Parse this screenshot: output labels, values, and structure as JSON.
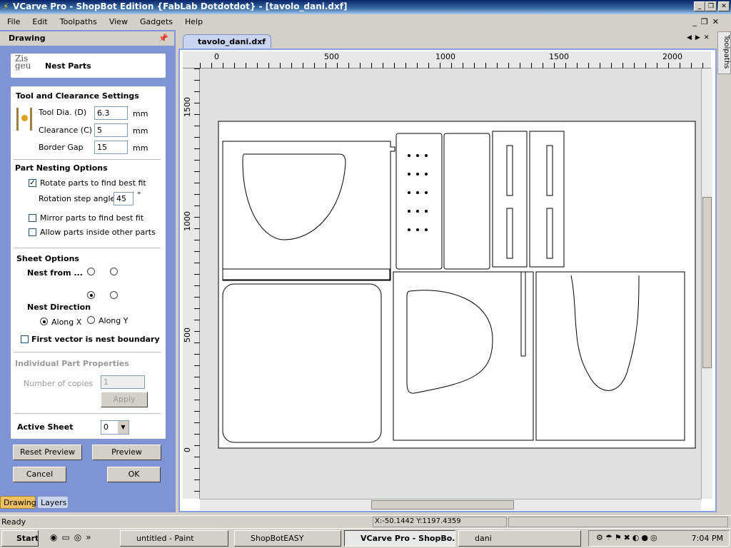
{
  "window": {
    "title": "VCarve Pro - ShopBot Edition {FabLab Dotdotdot} - [tavolo_dani.dxf]"
  },
  "menu": [
    "File",
    "Edit",
    "Toolpaths",
    "View",
    "Gadgets",
    "Help"
  ],
  "panel": {
    "title": "Drawing",
    "gadget_title": "Nest Parts",
    "tool_section": "Tool and Clearance Settings",
    "tool_dia_label": "Tool Dia. (D)",
    "tool_dia": "6.3",
    "clearance_label": "Clearance (C)",
    "clearance": "5",
    "border_label": "Border Gap",
    "border": "15",
    "unit": "mm",
    "nesting_section": "Part Nesting Options",
    "rotate_label": "Rotate parts to find best fit",
    "rotate_checked": true,
    "rotation_step_label": "Rotation step angle",
    "rotation_step": "45",
    "degree": "°",
    "mirror_label": "Mirror parts to find best fit",
    "mirror_checked": false,
    "inside_label": "Allow parts inside other parts",
    "inside_checked": false,
    "sheet_section": "Sheet Options",
    "nest_from_label": "Nest from ...",
    "nest_dir_label": "Nest Direction",
    "along_x": "Along X",
    "along_y": "Along Y",
    "direction": "Along X",
    "first_vector_label": "First vector is nest boundary",
    "first_vector_checked": false,
    "individual_section": "Individual Part Properties",
    "copies_label": "Number of copies",
    "copies": "1",
    "apply": "Apply",
    "active_sheet_label": "Active Sheet",
    "active_sheet": "0",
    "reset_preview": "Reset Preview",
    "preview": "Preview",
    "cancel": "Cancel",
    "ok": "OK",
    "tabs": [
      "Drawing",
      "Layers"
    ]
  },
  "document": {
    "tab": "tavolo_dani.dxf",
    "side_tab": "Toolpaths",
    "ruler_x": [
      "0",
      "500",
      "1000",
      "1500",
      "2000"
    ],
    "ruler_y": [
      "1500",
      "1000",
      "500",
      "0"
    ]
  },
  "status": {
    "text": "Ready",
    "coords": "X:-50.1442 Y:1197.4359"
  },
  "taskbar": {
    "start": "Start",
    "items": [
      "untitled - Paint",
      "ShopBotEASY",
      "VCarve Pro - ShopBo...",
      "dani"
    ],
    "active": "VCarve Pro - ShopBo...",
    "time": "7:04 PM"
  },
  "colors": {
    "panel_bg": "#7f94d6",
    "title_bar": "#0a246a"
  }
}
